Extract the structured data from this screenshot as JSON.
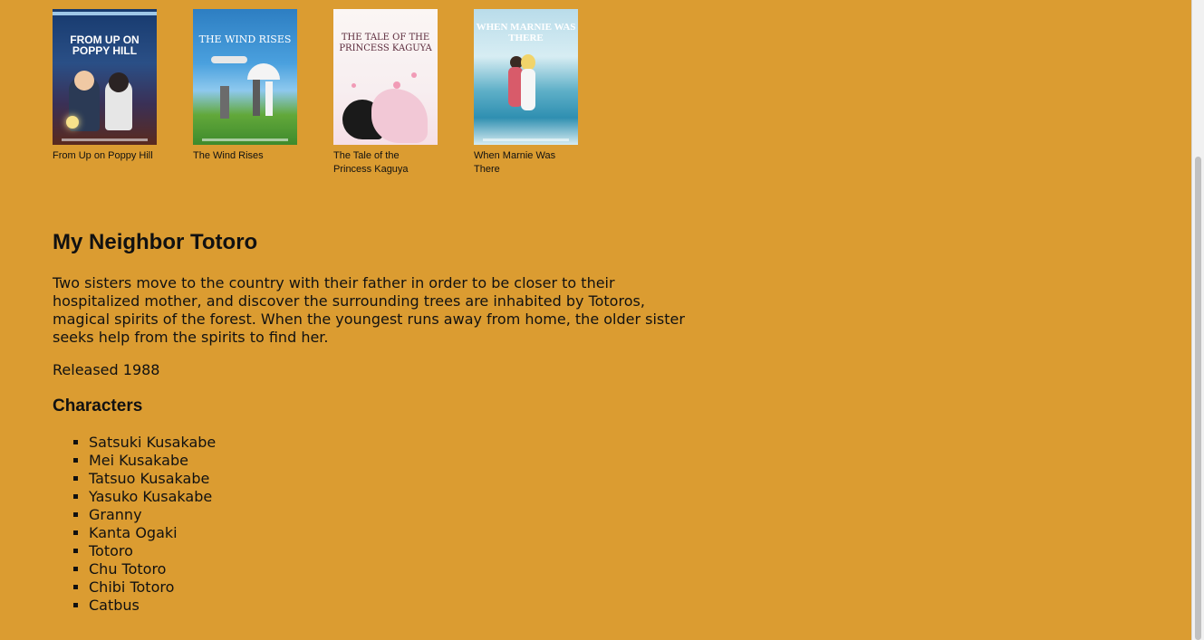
{
  "films": [
    {
      "title": "From Up on Poppy Hill",
      "poster_title": "FROM UP ON POPPY HILL"
    },
    {
      "title": "The Wind Rises",
      "poster_title": "THE WIND RISES"
    },
    {
      "title": "The Tale of the Princess Kaguya",
      "poster_title": "THE TALE OF THE PRINCESS KAGUYA"
    },
    {
      "title": "When Marnie Was There",
      "poster_title": "WHEN MARNIE WAS THERE"
    }
  ],
  "selected": {
    "title": "My Neighbor Totoro",
    "description": "Two sisters move to the country with their father in order to be closer to their hospitalized mother, and discover the surrounding trees are inhabited by Totoros, magical spirits of the forest. When the youngest runs away from home, the older sister seeks help from the spirits to find her.",
    "released": "Released 1988",
    "characters_heading": "Characters",
    "characters": [
      "Satsuki Kusakabe",
      "Mei Kusakabe",
      "Tatsuo Kusakabe",
      "Yasuko Kusakabe",
      "Granny",
      "Kanta Ogaki",
      "Totoro",
      "Chu Totoro",
      "Chibi Totoro",
      "Catbus"
    ]
  },
  "colors": {
    "background": "#db9c31",
    "text": "#111111"
  }
}
